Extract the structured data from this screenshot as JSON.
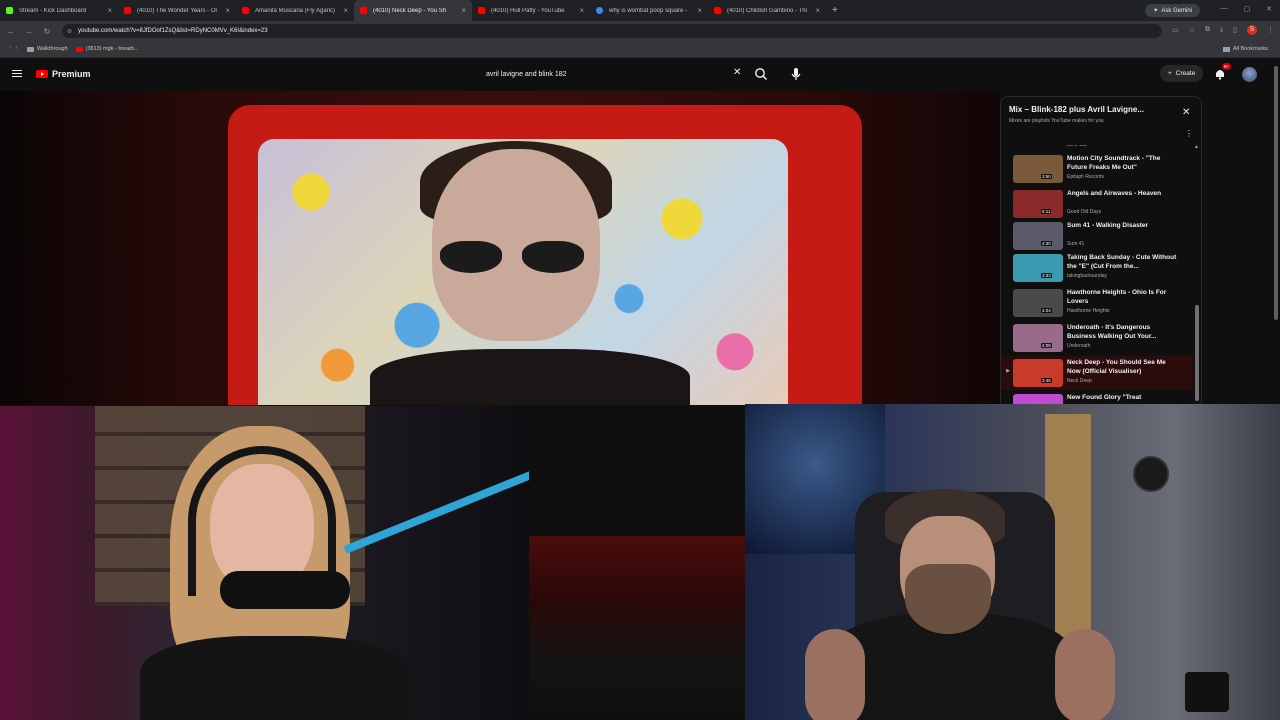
{
  "browser": {
    "tabs": [
      {
        "title": "Stream - Kick Dashboard",
        "color": "#53fc18",
        "active": false
      },
      {
        "title": "(4010) The Wonder Years - Ol",
        "color": "#ff0000",
        "active": false
      },
      {
        "title": "Amanita Muscaria (Fly Agaric)",
        "color": "#ff0000",
        "active": false
      },
      {
        "title": "(4010) Neck Deep - You Sh",
        "color": "#ff0000",
        "active": true
      },
      {
        "title": "(4010) Hull Patty - YouTube",
        "color": "#ff0000",
        "active": false
      },
      {
        "title": "why is wombat poop square -",
        "color": "#4285f4",
        "active": false
      },
      {
        "title": "(4010) Childish Gambino - Thi",
        "color": "#ff0000",
        "active": false
      }
    ],
    "ask_gemini": "Ask Gemini",
    "url": "youtube.com/watch?v=8JfDOof1ZsQ&list=RDyNC0MVv_K6I&index=23",
    "profile_initial": "S",
    "bookmarks": [
      {
        "label": "Walkthrough",
        "kind": "folder"
      },
      {
        "label": "(3813) mgk - breadi...",
        "kind": "youtube"
      }
    ],
    "all_bookmarks": "All Bookmarks"
  },
  "youtube": {
    "logo_text": "Premium",
    "search_value": "avril lavigne and blink 182",
    "create_label": "Create",
    "notification_count": "9+"
  },
  "playlist": {
    "title": "Mix – Blink-182 plus Avril Lavigne...",
    "subtitle": "Mixes are playlists YouTube makes for you",
    "top_channel": "blink-182",
    "items": [
      {
        "index": "",
        "title": "Motion City Soundtrack - \"The Future Freaks Me Out\"",
        "channel": "Epitaph Records",
        "duration": "3:50",
        "thumb": "#7a5a3a",
        "current": false
      },
      {
        "index": "",
        "title": "Angels and Airwaves - Heaven",
        "channel": "Good Old Days",
        "duration": "6:11",
        "thumb": "#8a2a2a",
        "current": false
      },
      {
        "index": "",
        "title": "Sum 41 - Walking Disaster",
        "channel": "Sum 41",
        "duration": "4:30",
        "thumb": "#5a5a6a",
        "current": false
      },
      {
        "index": "",
        "title": "Taking Back Sunday - Cute Without the \"E\" (Cut From the...",
        "channel": "takingbacksunday",
        "duration": "3:33",
        "thumb": "#3a9ab0",
        "current": false
      },
      {
        "index": "",
        "title": "Hawthorne Heights - Ohio Is For Lovers",
        "channel": "Hawthorne Heights",
        "duration": "4:04",
        "thumb": "#4a4a4a",
        "current": false
      },
      {
        "index": "",
        "title": "Underoath - It's Dangerous Business Walking Out Your...",
        "channel": "Underoath",
        "duration": "4:08",
        "thumb": "#9a6a8a",
        "current": false
      },
      {
        "index": "▶",
        "title": "Neck Deep - You Should See Me Now (Official Visualiser)",
        "channel": "Neck Deep",
        "duration": "3:46",
        "thumb": "#c83a2a",
        "current": true
      }
    ],
    "partial_title": "New Found Glory \"Treat"
  }
}
